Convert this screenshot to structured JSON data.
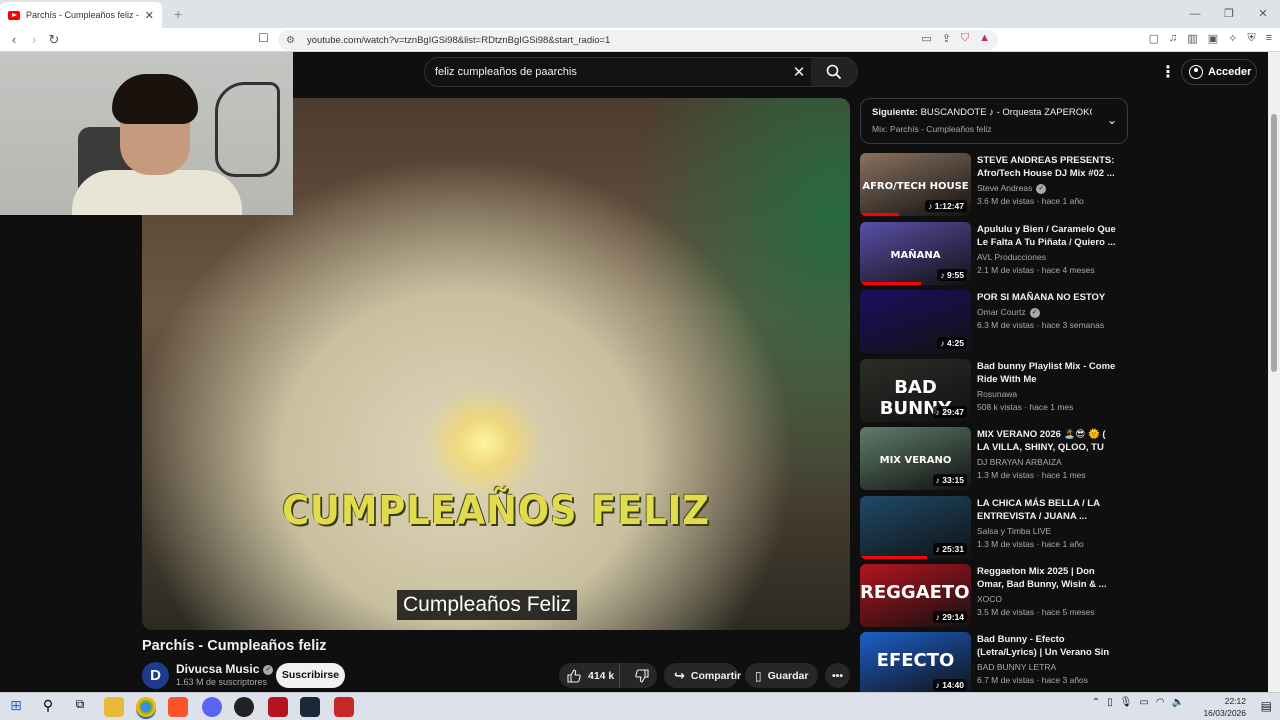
{
  "browser": {
    "tab_title": "Parchís - Cumpleaños feliz - You",
    "tab_close": "✕",
    "new_tab": "+",
    "url": "youtube.com/watch?v=tznBgIGSi98&list=RDtznBgIGSi98&start_radio=1",
    "window_controls": [
      "—",
      "❐",
      "✕"
    ]
  },
  "youtube": {
    "search_query": "feliz cumpleaños de paarchis",
    "signin_label": "Acceder",
    "video_overlay_text": "CUMPLEAÑOS FELIZ",
    "subtitle": "Cumpleaños Feliz",
    "video_title": "Parchís - Cumpleaños feliz",
    "channel": {
      "avatar_letter": "D",
      "name": "Divucsa Music",
      "subscribers": "1.63 M de suscriptores"
    },
    "subscribe_label": "Suscribirse",
    "likes": "414 k",
    "share_label": "Compartir",
    "save_label": "Guardar",
    "up_next": {
      "label": "Siguiente:",
      "title": "BUSCANDOTE ♪ - Orquesta ZAPEROKO L...",
      "mix": "Mix: Parchís - Cumpleaños feliz"
    },
    "recommendations": [
      {
        "title": "STEVE ANDREAS PRESENTS: Afro/Tech House DJ Mix #02 ...",
        "channel": "Steve Andreas",
        "verified": true,
        "meta": "3.6 M de vistas · hace 1 año",
        "duration": "1:12:47",
        "thumb_text": "AFRO/TECH HOUSE",
        "thumb_color": "#8a7260",
        "progress": 0.35
      },
      {
        "title": "Apululu y Bien / Caramelo Que Le Falta A Tu Piñata / Quiero ...",
        "channel": "AVL Producciones",
        "verified": false,
        "meta": "2.1 M de vistas · hace 4 meses",
        "duration": "9:55",
        "thumb_text": "MAÑANA",
        "thumb_color": "#5a4fa8",
        "progress": 0.55
      },
      {
        "title": "POR SI MAÑANA NO ESTOY",
        "channel": "Omar Courtz",
        "verified": true,
        "meta": "6.3 M de vistas · hace 3 semanas",
        "duration": "4:25",
        "thumb_text": "",
        "thumb_color": "#1a1060",
        "progress": 0
      },
      {
        "title": "Bad bunny Playlist Mix - Come Ride With Me",
        "channel": "Rosunawa",
        "verified": false,
        "meta": "508 k vistas · hace 1 mes",
        "duration": "29:47",
        "thumb_text": "BAD BUNNY",
        "thumb_color": "#2a2e28",
        "progress": 0
      },
      {
        "title": "MIX VERANO 2026 🏝️😎 🌞 ( LA VILLA, SHINY, QLOO, TU VA...",
        "channel": "DJ BRAYAN ARBAIZA",
        "verified": false,
        "meta": "1.3 M de vistas · hace 1 mes",
        "duration": "33:15",
        "thumb_text": "MIX VERANO",
        "thumb_color": "#5f7d6b",
        "progress": 0
      },
      {
        "title": "LA CHICA MÁS BELLA / LA ENTREVISTA / JUANA ...",
        "channel": "Salsa y Timba LIVE",
        "verified": false,
        "meta": "1.3 M de vistas · hace 1 año",
        "duration": "25:31",
        "thumb_text": "",
        "thumb_color": "#1f4a6a",
        "progress": 0.6
      },
      {
        "title": "Reggaeton Mix 2025 | Don Omar, Bad Bunny, Wisin & ...",
        "channel": "XOCO",
        "verified": false,
        "meta": "3.5 M de vistas · hace 5 meses",
        "duration": "29:14",
        "thumb_text": "REGGAETON",
        "thumb_color": "#b3141f",
        "progress": 0
      },
      {
        "title": "Bad Bunny - Efecto (Letra/Lyrics) | Un Verano Sin Ti",
        "channel": "BAD BUNNY LETRA",
        "verified": false,
        "meta": "6.7 M de vistas · hace 3 años",
        "duration": "14:40",
        "thumb_text": "EFECTO",
        "thumb_color": "#1d5fc9",
        "progress": 0
      }
    ]
  },
  "taskbar": {
    "time": "22:12",
    "date": "16/03/2026"
  }
}
